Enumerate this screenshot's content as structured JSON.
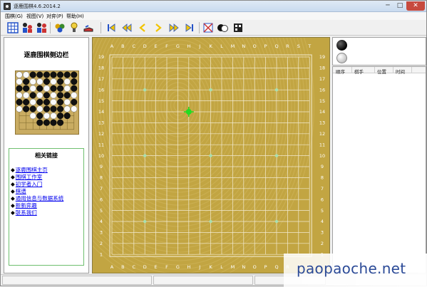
{
  "window": {
    "title": "逐鹿围棋4.6.2014.2",
    "controls": {
      "minimize": "─",
      "maximize": "□",
      "close": "✕"
    }
  },
  "menu": [
    "围棋(G)",
    "视图(V)",
    "对弈(P)",
    "帮助(H)"
  ],
  "toolbar": {
    "buttons": [
      "board-grid-icon",
      "player-vs-player-icon",
      "player-vs-computer-icon",
      "analyze-icon",
      "hint-icon",
      "shoe-icon",
      "first-move-icon",
      "back-fast-icon",
      "back-icon",
      "forward-icon",
      "forward-fast-icon",
      "last-move-icon",
      "network-icon",
      "stones-icon",
      "puzzle-icon"
    ]
  },
  "sidebar": {
    "title": "逐鹿围棋侧边栏",
    "links_title": "相关链接",
    "links": [
      "逐鹿围棋主页",
      "围棋工作室",
      "初学者入门",
      "棋谱",
      "通用信息与数据系统",
      "新新弈趣",
      "联系我们"
    ],
    "thumbnail_rows": [
      "wwbbbbbbb",
      "wbwwbwbwb",
      "bbwbwbbwb",
      "wwbwbwbbw",
      "bbwbbwbwb",
      "wbbwbbbww",
      "..wbwwbb.",
      "...bbbb..",
      "........."
    ]
  },
  "board": {
    "columns": [
      "A",
      "B",
      "C",
      "D",
      "E",
      "F",
      "G",
      "H",
      "J",
      "K",
      "L",
      "M",
      "N",
      "O",
      "P",
      "Q",
      "R",
      "S",
      "T"
    ],
    "rows": [
      "19",
      "18",
      "17",
      "16",
      "15",
      "14",
      "13",
      "12",
      "11",
      "10",
      "9",
      "8",
      "7",
      "6",
      "5",
      "4",
      "3",
      "2",
      "1"
    ],
    "star_points": [
      [
        4,
        4
      ],
      [
        10,
        4
      ],
      [
        16,
        4
      ],
      [
        4,
        10
      ],
      [
        10,
        10
      ],
      [
        16,
        10
      ],
      [
        4,
        16
      ],
      [
        10,
        16
      ],
      [
        16,
        16
      ]
    ],
    "highlight": {
      "col": 7,
      "row": 14
    },
    "colors": {
      "wood": "#c2a542",
      "grid": "#f2ead0",
      "star": "#a8e0b0",
      "highlight": "#22dd22"
    }
  },
  "right_panel": {
    "columns": [
      "顺序",
      "棋手",
      "位置",
      "时间"
    ],
    "stones": [
      "black",
      "white"
    ]
  },
  "watermark": "paopaoche.net"
}
